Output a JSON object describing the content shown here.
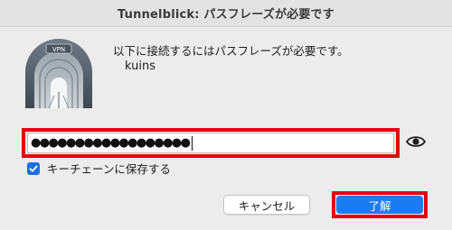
{
  "window": {
    "title": "Tunnelblick: パスフレーズが必要です"
  },
  "icon": {
    "name": "vpn-tunnel-icon",
    "badge": "VPN"
  },
  "dialog": {
    "message": "以下に接続するにはパスフレーズが必要です。",
    "account": "kuins"
  },
  "password": {
    "masked_value": "●●●●●●●●●●●●●●●●●●",
    "reveal_icon": "eye-icon"
  },
  "keychain": {
    "checked": true,
    "label": "キーチェーンに保存する"
  },
  "buttons": {
    "cancel": "キャンセル",
    "ok": "了解"
  },
  "colors": {
    "highlight": "#e30012",
    "accent": "#1b7cf2",
    "window_bg": "#ececec"
  }
}
